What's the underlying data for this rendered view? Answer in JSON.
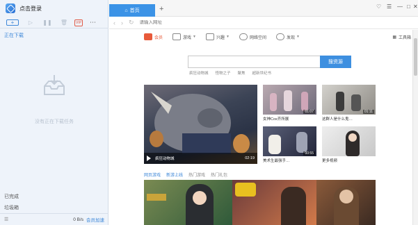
{
  "app": {
    "login_label": "点击登录"
  },
  "left_panel": {
    "categories": [
      "正在下载",
      "已完成",
      "垃圾箱"
    ],
    "empty_text": "没有正在下载任务",
    "speed": "0 B/s",
    "accelerate_label": "会员加速",
    "vip_badge": "VIP"
  },
  "browser": {
    "tab_label": "首页",
    "address_placeholder": "请输入网址",
    "nav_items": [
      {
        "label": "会员",
        "icon": "vip-logo-icon",
        "caret": false
      },
      {
        "label": "游戏",
        "icon": "game-icon",
        "caret": true
      },
      {
        "label": "兴趣",
        "icon": "interest-icon",
        "caret": true
      },
      {
        "label": "网络空间",
        "icon": "cloud-space-icon",
        "caret": false
      },
      {
        "label": "发现",
        "icon": "discover-icon",
        "caret": true
      }
    ],
    "toolbox_label": "工具箱",
    "search_button": "搜资源",
    "hot_words": [
      "疯狂动物城",
      "怪物之子",
      "聚焦",
      "超新世纪书"
    ],
    "main_video": {
      "title": "疯狂动物城",
      "duration": "02:19"
    },
    "thumbs": [
      {
        "caption": "女神Cos齐所展",
        "duration": "01:07"
      },
      {
        "caption": "这群人是什么鬼…",
        "duration": "01:11"
      },
      {
        "caption": "美术生最强手…",
        "duration": "00:55"
      },
      {
        "caption": "更多视频",
        "duration": ""
      }
    ],
    "section": {
      "title": "网页游戏",
      "tabs": [
        "新游上线",
        "热门游戏",
        "热门礼包"
      ]
    }
  },
  "colors": {
    "accent": "#3d8fe0",
    "tab_blue": "#3c93e6",
    "vip_red": "#e05a47"
  }
}
